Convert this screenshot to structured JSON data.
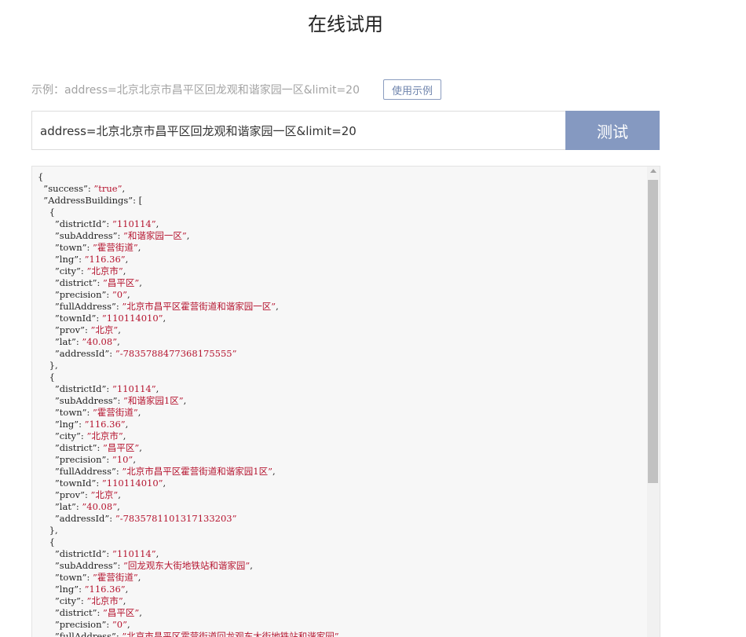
{
  "header": {
    "title": "在线试用"
  },
  "example": {
    "text": "示例：address=北京北京市昌平区回龙观和谐家园一区&limit=20",
    "button_label": "使用示例"
  },
  "query": {
    "value": "address=北京北京市昌平区回龙观和谐家园一区&limit=20",
    "submit_label": "测试"
  },
  "result": {
    "success": "true",
    "buildings_key": "AddressBuildings",
    "buildings": [
      {
        "districtId": "110114",
        "subAddress": "和谐家园一区",
        "town": "霍营街道",
        "lng": "116.36",
        "city": "北京市",
        "district": "昌平区",
        "precision": "0",
        "fullAddress": "北京市昌平区霍营街道和谐家园一区",
        "townId": "110114010",
        "prov": "北京",
        "lat": "40.08",
        "addressId": "-7835788477368175555"
      },
      {
        "districtId": "110114",
        "subAddress": "和谐家园1区",
        "town": "霍营街道",
        "lng": "116.36",
        "city": "北京市",
        "district": "昌平区",
        "precision": "10",
        "fullAddress": "北京市昌平区霍营街道和谐家园1区",
        "townId": "110114010",
        "prov": "北京",
        "lat": "40.08",
        "addressId": "-7835781101317133203"
      },
      {
        "districtId": "110114",
        "subAddress": "回龙观东大街地铁站和谐家园",
        "town": "霍营街道",
        "lng": "116.36",
        "city": "北京市",
        "district": "昌平区",
        "precision": "0",
        "fullAddress": "北京市昌平区霍营街道回龙观东大街地铁站和谐家园"
      }
    ]
  }
}
